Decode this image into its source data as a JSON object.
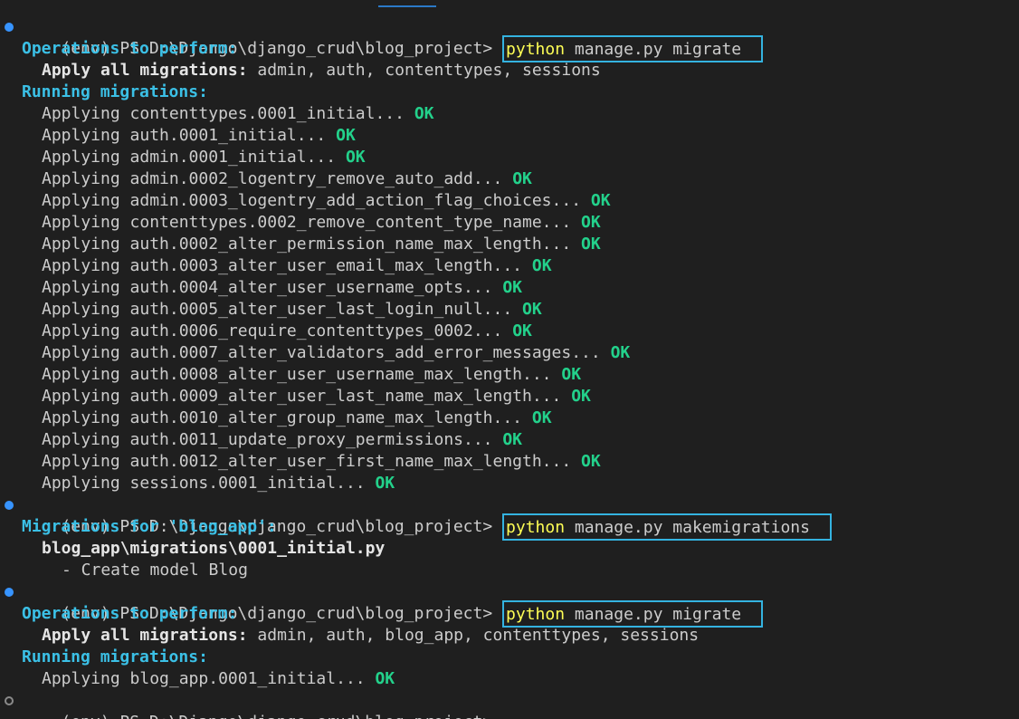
{
  "terminal": {
    "prompt": "(env) PS D:\\Django\\django_crud\\blog_project>",
    "colors": {
      "background": "#1f1f1f",
      "heading": "#3bc0e6",
      "ok": "#23d18b",
      "command_keyword": "#ffff55",
      "highlight_box": "#34b3e0",
      "prompt_dot": "#3794ff"
    },
    "block1": {
      "cmd_keyword": "python",
      "cmd_rest": " manage.py migrate",
      "ops_heading": "Operations to perform:",
      "apply_label": "Apply all migrations:",
      "apply_list": " admin, auth, contenttypes, sessions",
      "running_heading": "Running migrations:",
      "migrations": [
        {
          "text": "Applying contenttypes.0001_initial...",
          "status": "OK"
        },
        {
          "text": "Applying auth.0001_initial...",
          "status": "OK"
        },
        {
          "text": "Applying admin.0001_initial...",
          "status": "OK"
        },
        {
          "text": "Applying admin.0002_logentry_remove_auto_add...",
          "status": "OK"
        },
        {
          "text": "Applying admin.0003_logentry_add_action_flag_choices...",
          "status": "OK"
        },
        {
          "text": "Applying contenttypes.0002_remove_content_type_name...",
          "status": "OK"
        },
        {
          "text": "Applying auth.0002_alter_permission_name_max_length...",
          "status": "OK"
        },
        {
          "text": "Applying auth.0003_alter_user_email_max_length...",
          "status": "OK"
        },
        {
          "text": "Applying auth.0004_alter_user_username_opts...",
          "status": "OK"
        },
        {
          "text": "Applying auth.0005_alter_user_last_login_null...",
          "status": "OK"
        },
        {
          "text": "Applying auth.0006_require_contenttypes_0002...",
          "status": "OK"
        },
        {
          "text": "Applying auth.0007_alter_validators_add_error_messages...",
          "status": "OK"
        },
        {
          "text": "Applying auth.0008_alter_user_username_max_length...",
          "status": "OK"
        },
        {
          "text": "Applying auth.0009_alter_user_last_name_max_length...",
          "status": "OK"
        },
        {
          "text": "Applying auth.0010_alter_group_name_max_length...",
          "status": "OK"
        },
        {
          "text": "Applying auth.0011_update_proxy_permissions...",
          "status": "OK"
        },
        {
          "text": "Applying auth.0012_alter_user_first_name_max_length...",
          "status": "OK"
        },
        {
          "text": "Applying sessions.0001_initial...",
          "status": "OK"
        }
      ]
    },
    "block2": {
      "cmd_keyword": "python",
      "cmd_rest": " manage.py makemigrations",
      "migrations_for": "Migrations for 'blog_app':",
      "file": "blog_app\\migrations\\0001_initial.py",
      "action": "- Create model Blog"
    },
    "block3": {
      "cmd_keyword": "python",
      "cmd_rest": " manage.py migrate",
      "ops_heading": "Operations to perform:",
      "apply_label": "Apply all migrations:",
      "apply_list": " admin, auth, blog_app, contenttypes, sessions",
      "running_heading": "Running migrations:",
      "migration_text": "Applying blog_app.0001_initial...",
      "migration_status": "OK"
    }
  }
}
